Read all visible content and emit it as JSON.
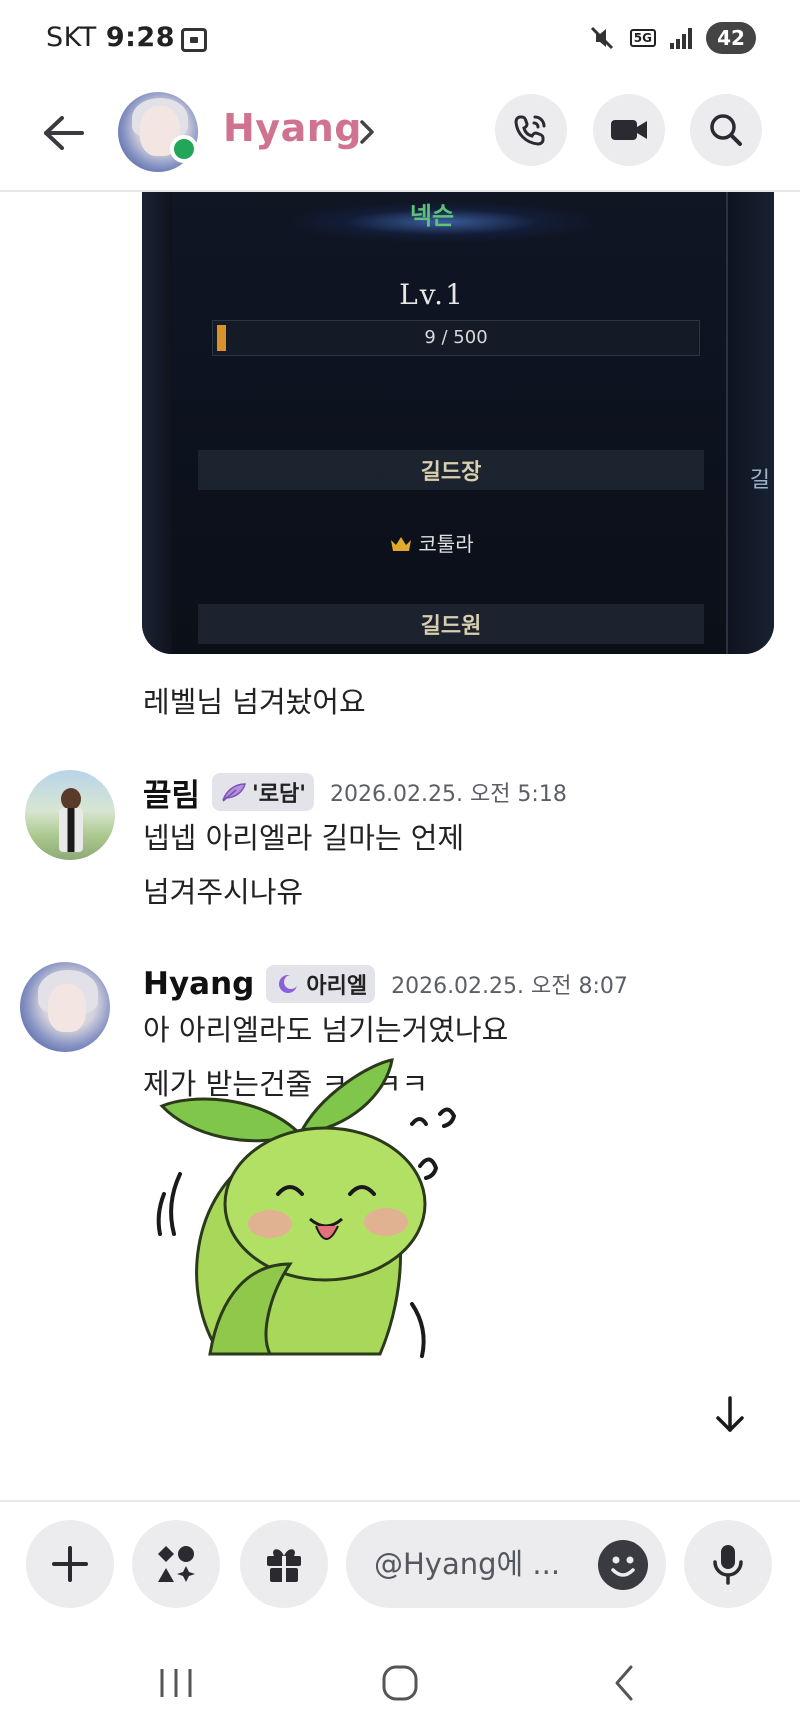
{
  "status_bar": {
    "carrier": "SKT",
    "time": "9:28",
    "network": "5G",
    "battery": "42"
  },
  "header": {
    "channel_name": "Hyang",
    "name_color": "#d07390",
    "status": "online"
  },
  "screenshot": {
    "guild_name": "넥슨",
    "level": "Lv.1",
    "xp_text": "9 / 500",
    "xp_progress": 0.018,
    "leader_section": "길드장",
    "leader_name": "코툴라",
    "member_section": "길드원",
    "side_label": "길"
  },
  "messages": [
    {
      "author": "Hyang",
      "lines": [
        "레벨님 넘겨놨어요"
      ]
    },
    {
      "author": "끌림",
      "role": "'로담'",
      "timestamp": "2026.02.25. 오전 5:18",
      "lines": [
        "넵넵 아리엘라 길마는 언제",
        "넘겨주시나유"
      ]
    },
    {
      "author": "Hyang",
      "role": "아리엘",
      "timestamp": "2026.02.25. 오전 8:07",
      "lines": [
        "아 아리엘라도 넘기는거였나요",
        "제가 받는건줄 ㅋㅋㅋㅋ"
      ],
      "attachment": "sticker"
    }
  ],
  "composer": {
    "placeholder": "@Hyang에 ..."
  },
  "colors": {
    "accent_online": "#23a55a",
    "button_bg": "#ececef",
    "xp_fill": "#d9912c",
    "guild_title": "#5ec27a"
  }
}
